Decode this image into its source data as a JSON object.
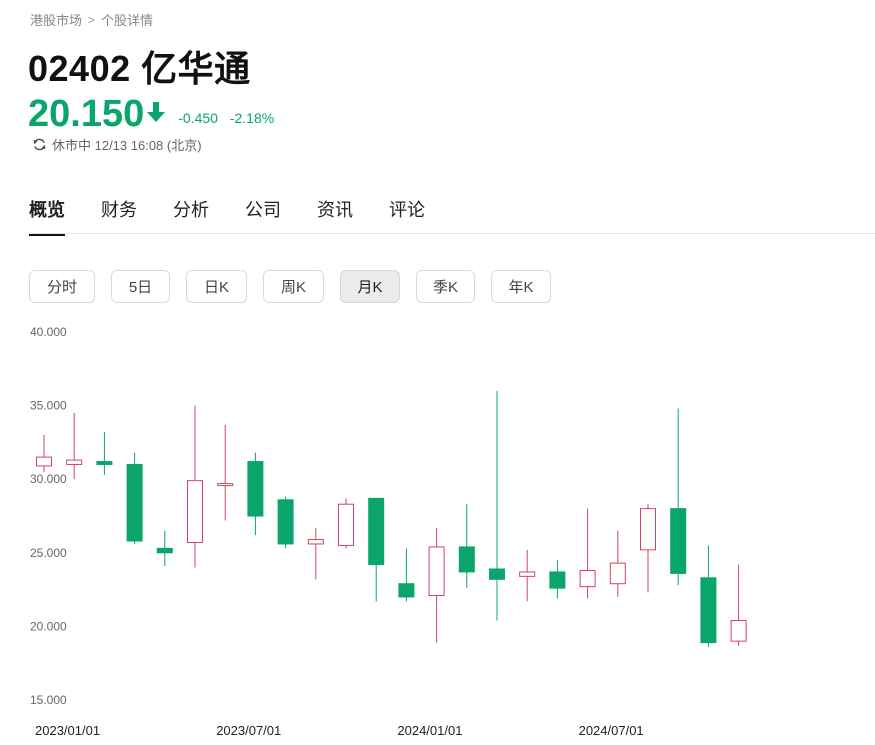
{
  "breadcrumb": {
    "market": "港股市场",
    "separator": ">",
    "current": "个股详情"
  },
  "stock": {
    "title": "02402 亿华通"
  },
  "quote": {
    "price": "20.150",
    "change": "-0.450",
    "change_pct": "-2.18%",
    "direction": "down",
    "color": "#0aa56b"
  },
  "status": {
    "text": "休市中 12/13 16:08 (北京)"
  },
  "tabs": [
    {
      "label": "概览",
      "active": true
    },
    {
      "label": "财务",
      "active": false
    },
    {
      "label": "分析",
      "active": false
    },
    {
      "label": "公司",
      "active": false
    },
    {
      "label": "资讯",
      "active": false
    },
    {
      "label": "评论",
      "active": false
    }
  ],
  "periods": [
    {
      "label": "分时",
      "active": false
    },
    {
      "label": "5日",
      "active": false
    },
    {
      "label": "日K",
      "active": false
    },
    {
      "label": "周K",
      "active": false
    },
    {
      "label": "月K",
      "active": true
    },
    {
      "label": "季K",
      "active": false
    },
    {
      "label": "年K",
      "active": false
    }
  ],
  "colors": {
    "up": "#d0465e",
    "down": "#0aa56b",
    "text": "#222222",
    "muted": "#888888"
  },
  "chart_data": {
    "type": "candlestick",
    "ylim": [
      15,
      40
    ],
    "y_ticks": [
      "40.000",
      "35.000",
      "30.000",
      "25.000",
      "20.000",
      "15.000"
    ],
    "x_ticks": [
      {
        "label": "2023/01/01",
        "index": 0
      },
      {
        "label": "2023/07/01",
        "index": 6
      },
      {
        "label": "2024/01/01",
        "index": 12
      },
      {
        "label": "2024/07/01",
        "index": 18
      }
    ],
    "candles": [
      {
        "month": "2023/01",
        "open": 30.9,
        "close": 31.5,
        "high": 33.0,
        "low": 30.5
      },
      {
        "month": "2023/02",
        "open": 31.0,
        "close": 31.3,
        "high": 34.5,
        "low": 30.0
      },
      {
        "month": "2023/03",
        "open": 31.2,
        "close": 31.0,
        "high": 33.2,
        "low": 30.3
      },
      {
        "month": "2023/04",
        "open": 31.0,
        "close": 25.8,
        "high": 31.8,
        "low": 25.6
      },
      {
        "month": "2023/05",
        "open": 25.3,
        "close": 25.0,
        "high": 26.5,
        "low": 24.1
      },
      {
        "month": "2023/06",
        "open": 25.7,
        "close": 29.9,
        "high": 35.0,
        "low": 24.0
      },
      {
        "month": "2023/07",
        "open": 29.6,
        "close": 29.7,
        "high": 33.7,
        "low": 27.2
      },
      {
        "month": "2023/08",
        "open": 31.2,
        "close": 27.5,
        "high": 31.8,
        "low": 26.2
      },
      {
        "month": "2023/09",
        "open": 28.6,
        "close": 25.6,
        "high": 28.8,
        "low": 25.3
      },
      {
        "month": "2023/10",
        "open": 25.6,
        "close": 25.9,
        "high": 26.7,
        "low": 23.2
      },
      {
        "month": "2023/11",
        "open": 25.5,
        "close": 28.3,
        "high": 28.7,
        "low": 25.3
      },
      {
        "month": "2023/12",
        "open": 28.7,
        "close": 24.2,
        "high": 28.7,
        "low": 21.7
      },
      {
        "month": "2024/01",
        "open": 22.9,
        "close": 22.0,
        "high": 25.3,
        "low": 21.7
      },
      {
        "month": "2024/02",
        "open": 22.1,
        "close": 25.4,
        "high": 26.7,
        "low": 18.9
      },
      {
        "month": "2024/03",
        "open": 25.4,
        "close": 23.7,
        "high": 28.3,
        "low": 22.6
      },
      {
        "month": "2024/04",
        "open": 23.9,
        "close": 23.2,
        "high": 36.0,
        "low": 20.4
      },
      {
        "month": "2024/05",
        "open": 23.4,
        "close": 23.7,
        "high": 25.2,
        "low": 21.7
      },
      {
        "month": "2024/06",
        "open": 23.7,
        "close": 22.6,
        "high": 24.5,
        "low": 21.9
      },
      {
        "month": "2024/07",
        "open": 22.7,
        "close": 23.8,
        "high": 28.0,
        "low": 21.9
      },
      {
        "month": "2024/08",
        "open": 22.9,
        "close": 24.3,
        "high": 26.5,
        "low": 22.0
      },
      {
        "month": "2024/09",
        "open": 25.2,
        "close": 28.0,
        "high": 28.3,
        "low": 22.3
      },
      {
        "month": "2024/10",
        "open": 28.0,
        "close": 23.6,
        "high": 34.8,
        "low": 22.8
      },
      {
        "month": "2024/11",
        "open": 23.3,
        "close": 18.9,
        "high": 25.5,
        "low": 18.6
      },
      {
        "month": "2024/12",
        "open": 19.0,
        "close": 20.4,
        "high": 24.2,
        "low": 18.7
      }
    ]
  }
}
